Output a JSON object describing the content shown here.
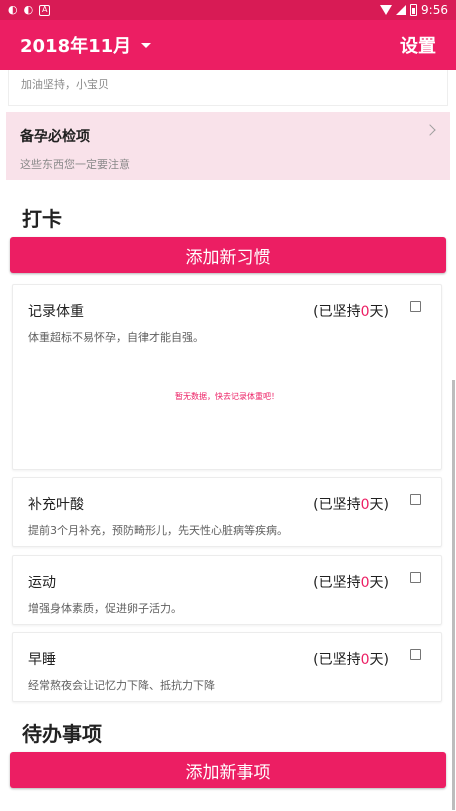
{
  "status_bar": {
    "icons": [
      "weibo-icon",
      "weibo-icon",
      "app-a-icon"
    ],
    "time": "9:56"
  },
  "toolbar": {
    "month": "2018年11月",
    "settings_label": "设置"
  },
  "motto": {
    "text": "加油坚持，小宝贝"
  },
  "checkup": {
    "title": "备孕必检项",
    "subtitle": "这些东西您一定要注意"
  },
  "habits_section": {
    "heading": "打卡",
    "add_button": "添加新习惯",
    "items": [
      {
        "name": "记录体重",
        "streak_prefix": "(已坚持",
        "streak_days": "0",
        "streak_suffix": "天)",
        "desc": "体重超标不易怀孕，自律才能自强。",
        "empty": "暂无数据，快去记录体重吧！"
      },
      {
        "name": "补充叶酸",
        "streak_prefix": "(已坚持",
        "streak_days": "0",
        "streak_suffix": "天)",
        "desc": "提前3个月补充，预防畸形儿，先天性心脏病等疾病。"
      },
      {
        "name": "运动",
        "streak_prefix": "(已坚持",
        "streak_days": "0",
        "streak_suffix": "天)",
        "desc": "增强身体素质，促进卵子活力。"
      },
      {
        "name": "早睡",
        "streak_prefix": "(已坚持",
        "streak_days": "0",
        "streak_suffix": "天)",
        "desc": "经常熬夜会让记忆力下降、抵抗力下降"
      }
    ]
  },
  "todo_section": {
    "heading": "待办事项",
    "add_button": "添加新事项"
  },
  "colors": {
    "primary": "#ec1e63",
    "status_bar": "#d81b55",
    "card_pink": "#f9e2ea"
  }
}
